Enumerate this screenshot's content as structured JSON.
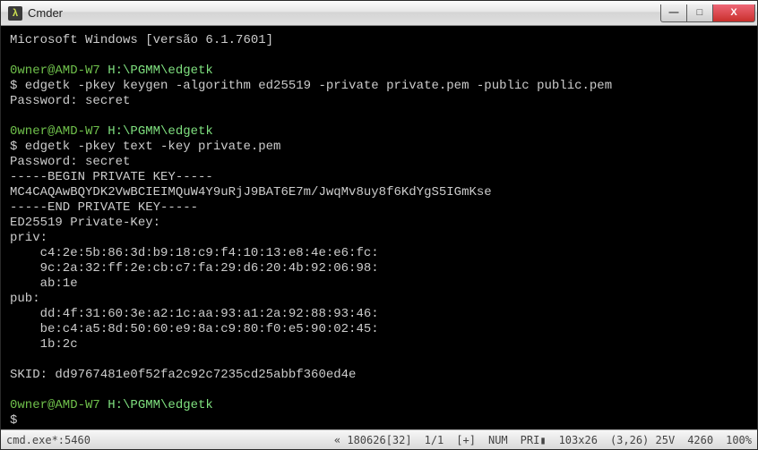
{
  "window": {
    "icon_glyph": "λ",
    "title": "Cmder",
    "buttons": {
      "min": "—",
      "max": "□",
      "close": "X"
    }
  },
  "terminal": {
    "line1": "Microsoft Windows [versão 6.1.7601]",
    "blank": " ",
    "prompt1_user": "0wner@AMD-W7 ",
    "prompt1_path": "H:\\PGMM\\edgetk",
    "cmd1": "$ edgetk -pkey keygen -algorithm ed25519 -private private.pem -public public.pem",
    "out1": "Password: secret",
    "prompt2_user": "0wner@AMD-W7 ",
    "prompt2_path": "H:\\PGMM\\edgetk",
    "cmd2": "$ edgetk -pkey text -key private.pem",
    "out2": "Password: secret",
    "out3": "-----BEGIN PRIVATE KEY-----",
    "out4": "MC4CAQAwBQYDK2VwBCIEIMQuW4Y9uRjJ9BAT6E7m/JwqMv8uy8f6KdYgS5IGmKse",
    "out5": "-----END PRIVATE KEY-----",
    "out6": "ED25519 Private-Key:",
    "out7": "priv:",
    "out8": "    c4:2e:5b:86:3d:b9:18:c9:f4:10:13:e8:4e:e6:fc:",
    "out9": "    9c:2a:32:ff:2e:cb:c7:fa:29:d6:20:4b:92:06:98:",
    "out10": "    ab:1e",
    "out11": "pub:",
    "out12": "    dd:4f:31:60:3e:a2:1c:aa:93:a1:2a:92:88:93:46:",
    "out13": "    be:c4:a5:8d:50:60:e9:8a:c9:80:f0:e5:90:02:45:",
    "out14": "    1b:2c",
    "out15": "SKID: dd9767481e0f52fa2c92c7235cd25abbf360ed4e",
    "prompt3_user": "0wner@AMD-W7 ",
    "prompt3_path": "H:\\PGMM\\edgetk",
    "cmd3": "$"
  },
  "status": {
    "left": "cmd.exe*:5460",
    "seg1": "« 180626[32]",
    "seg2": "1/1",
    "seg3": "[+]",
    "seg4": "NUM",
    "seg5": "PRI▮",
    "seg6": "103x26",
    "seg7": "(3,26) 25V",
    "seg8": "4260",
    "seg9": "100%"
  }
}
